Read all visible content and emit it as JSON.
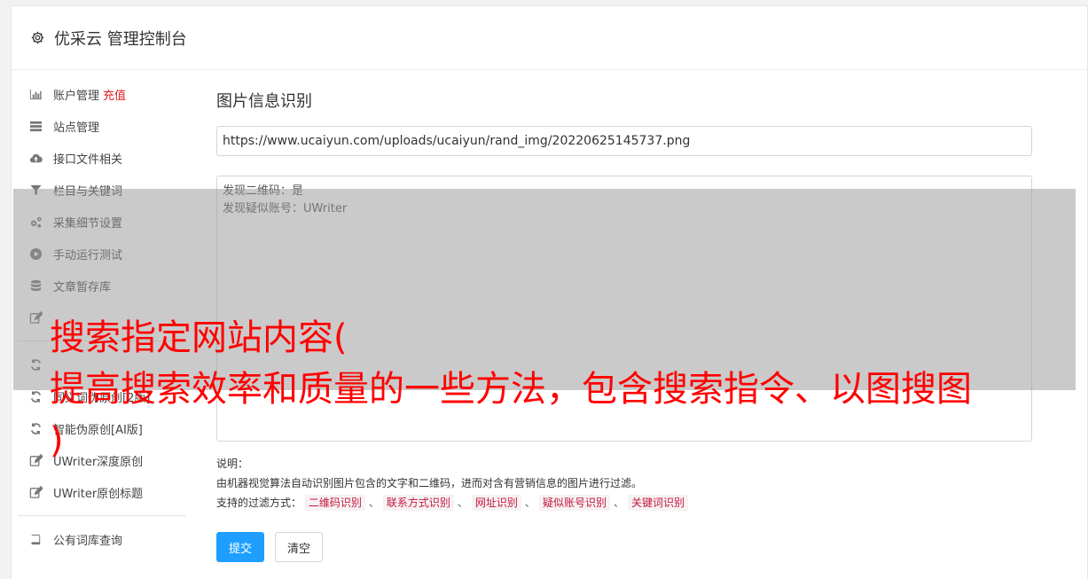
{
  "header": {
    "title": "优采云 管理控制台",
    "icon": "gear-icon"
  },
  "sidebar": {
    "items": [
      {
        "label": "账户管理",
        "extra": "充值",
        "icon": "bar-chart-icon"
      },
      {
        "label": "站点管理",
        "icon": "server-icon"
      },
      {
        "label": "接口文件相关",
        "icon": "cloud-upload-icon"
      },
      {
        "label": "栏目与关键词",
        "icon": "filter-icon"
      },
      {
        "label": "采集细节设置",
        "icon": "gears-icon"
      },
      {
        "label": "手动运行测试",
        "icon": "play-circle-icon"
      },
      {
        "label": "文章暂存库",
        "icon": "database-icon"
      },
      {
        "label": "",
        "icon": "edit-icon"
      },
      {
        "label": "",
        "icon": "refresh-icon"
      },
      {
        "label": "同义词伪原创[2版]",
        "icon": "refresh-icon"
      },
      {
        "label": "智能伪原创[AI版]",
        "icon": "refresh-icon"
      },
      {
        "label": "UWriter深度原创",
        "icon": "edit-icon"
      },
      {
        "label": "UWriter原创标题",
        "icon": "edit-icon"
      },
      {
        "label": "公有词库查询",
        "icon": "book-icon"
      }
    ]
  },
  "main": {
    "title": "图片信息识别",
    "url_value": "https://www.ucaiyun.com/uploads/ucaiyun/rand_img/20220625145737.png",
    "result_lines": [
      "发现二维码：是",
      "发现疑似账号：UWriter"
    ],
    "notes": {
      "label": "说明：",
      "desc": "由机器视觉算法自动识别图片包含的文字和二维码，进而对含有营销信息的图片进行过滤。",
      "filter_label": "支持的过滤方式：",
      "tags": [
        "二维码识别",
        "联系方式识别",
        "网址识别",
        "疑似账号识别",
        "关键词识别"
      ],
      "separator": "、"
    },
    "buttons": {
      "submit": "提交",
      "clear": "清空"
    }
  },
  "overlay": {
    "line1": "搜索指定网站内容(",
    "line2": "提高搜索效率和质量的一些方法，包含搜索指令、以图搜图",
    "line3": ")"
  },
  "colors": {
    "accent": "#1e9fff",
    "tag_text": "#c4173f",
    "overlay_text": "#ff0000",
    "recharge": "#e02020"
  }
}
